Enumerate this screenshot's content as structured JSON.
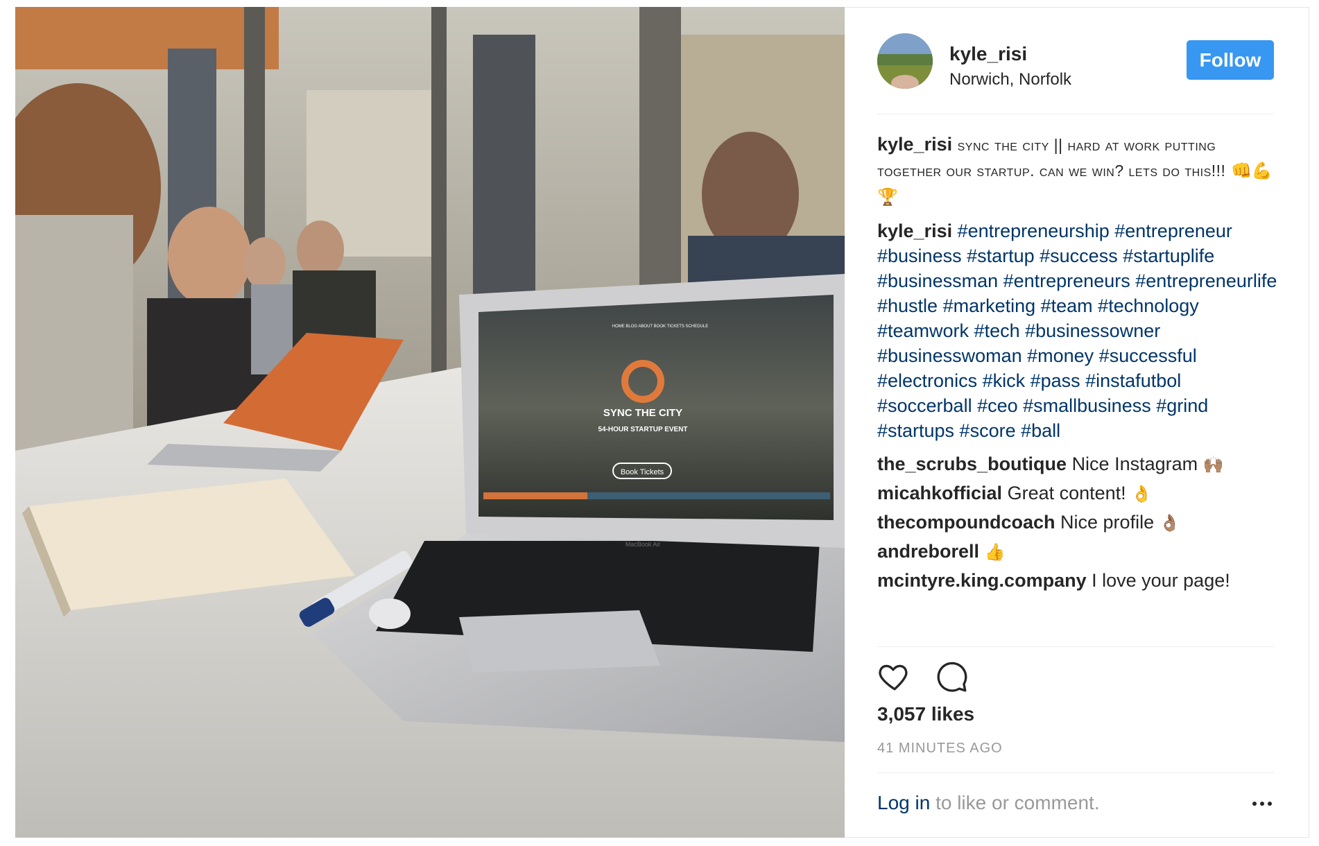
{
  "post": {
    "username": "kyle_risi",
    "location": "Norwich, Norfolk",
    "follow_label": "Follow",
    "caption": {
      "user": "kyle_risi",
      "text": "SYNC THE CITY || HARD AT WORK PUTTING TOGETHER OUR STARTUP. CAN WE WIN? LETS DO THIS!!!",
      "emoji": "👊💪🏆"
    },
    "hashtag_comment": {
      "user": "kyle_risi",
      "text": "#entrepreneurship #entrepreneur #business #startup #success #startuplife #businessman #entrepreneurs #entrepreneurlife #hustle #marketing #team #technology #teamwork #tech #businessowner #businesswoman #money #successful #electronics #kick #pass #instafutbol #soccerball #ceo #smallbusiness #grind #startups #score #ball"
    },
    "comments": [
      {
        "user": "the_scrubs_boutique",
        "text": "Nice Instagram",
        "emoji": "🙌🏽"
      },
      {
        "user": "micahkofficial",
        "text": "Great content!",
        "emoji": "👌"
      },
      {
        "user": "thecompoundcoach",
        "text": "Nice profile",
        "emoji": "👌🏽"
      },
      {
        "user": "andreborell",
        "text": "",
        "emoji": "👍"
      },
      {
        "user": "mcintyre.king.company",
        "text": "I love your page!",
        "emoji": ""
      }
    ],
    "likes": "3,057 likes",
    "timestamp": "41 MINUTES AGO",
    "login_link": "Log in",
    "login_suffix": "to like or comment.",
    "icons": {
      "like": "heart-icon",
      "comment": "comment-icon",
      "more": "more-options-icon"
    },
    "colors": {
      "follow_bg": "#3897f0",
      "hashtag": "#003569",
      "muted": "#999999"
    }
  },
  "photo": {
    "laptop_screen": {
      "nav": "HOME  BLOG  ABOUT  BOOK TICKETS  SCHEDULE",
      "title": "SYNC THE CITY",
      "subtitle": "54-HOUR STARTUP EVENT",
      "cta": "Book Tickets",
      "brand": "MacBook Air"
    }
  }
}
